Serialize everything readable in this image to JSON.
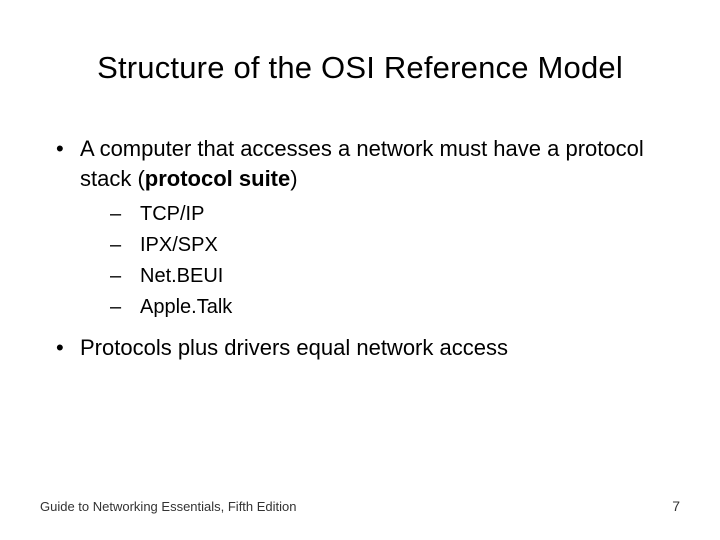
{
  "title": "Structure of the OSI Reference Model",
  "bullets": [
    {
      "text_pre": "A computer that accesses a network must have a protocol stack (",
      "bold": "protocol suite",
      "text_post": ")",
      "sub": [
        "TCP/IP",
        "IPX/SPX",
        "Net.BEUI",
        "Apple.Talk"
      ]
    },
    {
      "text_pre": "Protocols plus drivers equal network access",
      "bold": "",
      "text_post": "",
      "sub": []
    }
  ],
  "footer": {
    "source": "Guide to Networking Essentials, Fifth Edition",
    "page": "7"
  },
  "marks": {
    "bullet": "•",
    "dash": "–"
  }
}
